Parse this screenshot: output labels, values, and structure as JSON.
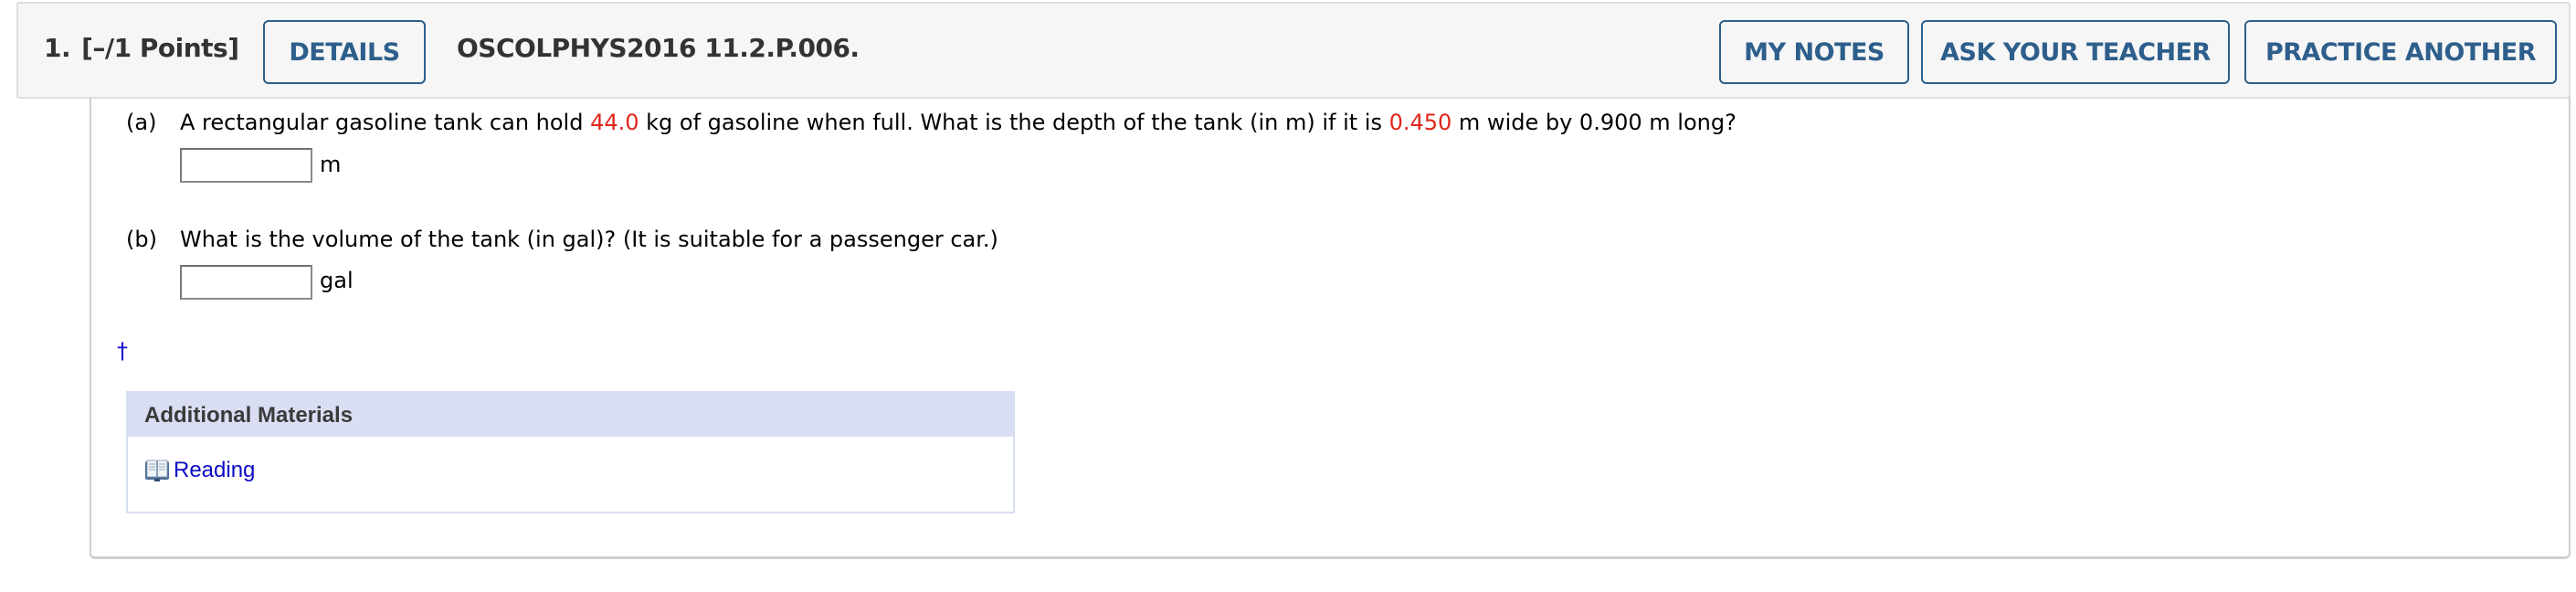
{
  "header": {
    "question_number": "1.",
    "points": "[–/1 Points]",
    "details_label": "DETAILS",
    "problem_id": "OSCOLPHYS2016 11.2.P.006.",
    "my_notes_label": "MY NOTES",
    "ask_teacher_label": "ASK YOUR TEACHER",
    "practice_another_label": "PRACTICE ANOTHER"
  },
  "colors": {
    "accent": "#2e5f8c",
    "given_value": "#e0261c",
    "link": "#0a0ac4",
    "additional_header_bg": "#d9def3"
  },
  "parts": [
    {
      "label": "(a)",
      "text_1": "A rectangular gasoline tank can hold ",
      "value_1": "44.0",
      "text_2": " kg of gasoline when full. What is the depth of the tank (in m) if it is ",
      "value_2": "0.450",
      "text_3": " m wide by 0.900 m long?",
      "answer_value": "",
      "unit": "m"
    },
    {
      "label": "(b)",
      "text_1": "What is the volume of the tank (in gal)? (It is suitable for a passenger car.)",
      "answer_value": "",
      "unit": "gal"
    }
  ],
  "footnote_marker": "†",
  "additional_materials": {
    "title": "Additional Materials",
    "items": [
      {
        "icon": "book-icon",
        "label": "Reading"
      }
    ]
  }
}
